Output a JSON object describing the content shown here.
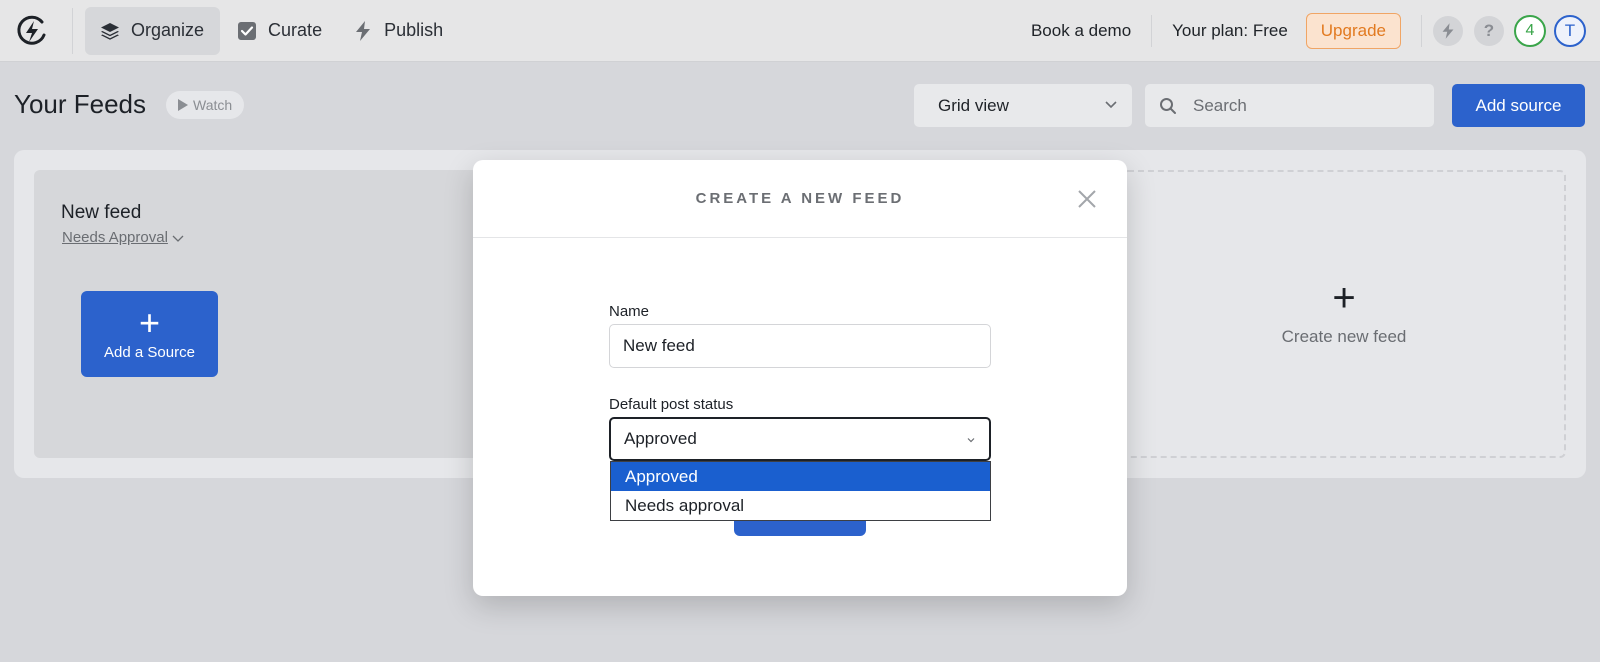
{
  "nav": {
    "tabs": [
      {
        "label": "Organize",
        "icon": "layers-icon"
      },
      {
        "label": "Curate",
        "icon": "checkbox-icon"
      },
      {
        "label": "Publish",
        "icon": "lightning-icon"
      }
    ],
    "book_demo": "Book a demo",
    "plan": "Your plan: Free",
    "upgrade": "Upgrade",
    "help_glyph": "?",
    "progress_count": "4",
    "avatar_initial": "T"
  },
  "header": {
    "title": "Your Feeds",
    "watch": "Watch",
    "view_select": "Grid view",
    "search_placeholder": "Search",
    "add_source": "Add source"
  },
  "feeds": {
    "card": {
      "name": "New feed",
      "status": "Needs Approval",
      "add_source_label": "Add a Source",
      "plus_glyph": "+"
    },
    "create_new_label": "Create new feed",
    "create_new_plus": "+"
  },
  "modal": {
    "title": "CREATE A NEW FEED",
    "name_label": "Name",
    "name_value": "New feed",
    "status_label": "Default post status",
    "status_value": "Approved",
    "options": [
      "Approved",
      "Needs approval"
    ]
  },
  "colors": {
    "accent": "#2c62cc",
    "upgrade_text": "#e27a20",
    "progress": "#3aa54a",
    "dropdown_selected": "#1a5fcf"
  }
}
